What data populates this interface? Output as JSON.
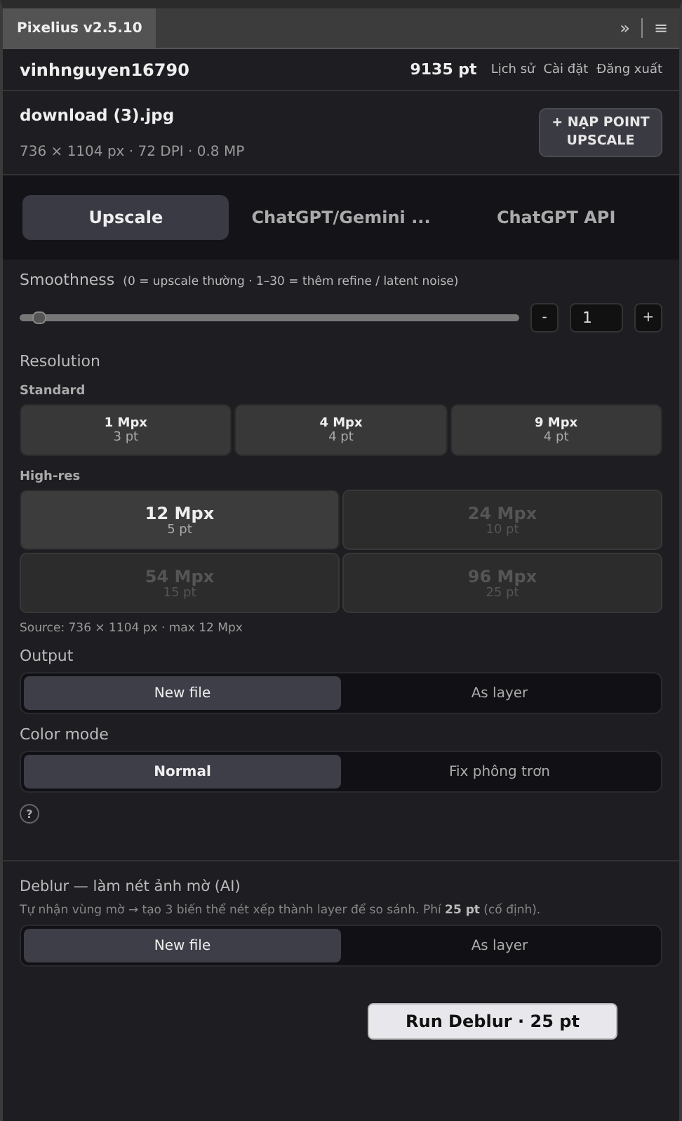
{
  "panel_tab": {
    "title": "Pixelius v2.5.10",
    "controls": [
      "»",
      "≡"
    ]
  },
  "account": {
    "username": "vinhnguyen16790",
    "points": "9135 pt",
    "links": [
      "Lịch sử",
      "Cài đặt",
      "Đăng xuất"
    ]
  },
  "file": {
    "name": "download (3).jpg",
    "info": "736 × 1104 px · 72 DPI · 0.8 MP",
    "topup_button": "+ NẠP POINT UPSCALE"
  },
  "tabs": [
    {
      "label": "Upscale",
      "selected": true
    },
    {
      "label": "ChatGPT/Gemini ...",
      "selected": false
    },
    {
      "label": "ChatGPT API",
      "selected": false
    }
  ],
  "smoothness": {
    "label": "Smoothness",
    "hint": "(0 = upscale thường · 1–30 = thêm refine / latent noise)",
    "level": 0.03,
    "minus": "-",
    "value": "1",
    "plus": "+"
  },
  "resolution": {
    "label": "Resolution",
    "standard": {
      "label": "Standard",
      "options": [
        {
          "size": "1 Mpx",
          "cost": "3 pt",
          "selected": false
        },
        {
          "size": "4 Mpx",
          "cost": "4 pt",
          "selected": false
        },
        {
          "size": "9 Mpx",
          "cost": "4 pt",
          "selected": false
        }
      ]
    },
    "high_res": {
      "label": "High-res",
      "options": [
        {
          "size": "12 Mpx",
          "cost": "5 pt",
          "disabled": false
        },
        {
          "size": "24 Mpx",
          "cost": "10 pt",
          "disabled": true
        },
        {
          "size": "54 Mpx",
          "cost": "15 pt",
          "disabled": true
        },
        {
          "size": "96 Mpx",
          "cost": "25 pt",
          "disabled": true
        }
      ]
    },
    "source_note": "Source: 736 × 1104 px · max 12 Mpx"
  },
  "output": {
    "label": "Output",
    "options": [
      {
        "label": "New file",
        "selected": true
      },
      {
        "label": "As layer",
        "selected": false
      }
    ]
  },
  "color_mode": {
    "label": "Color mode",
    "options": [
      {
        "label": "Normal",
        "selected": true
      },
      {
        "label": "Fix phông trơn",
        "selected": false
      }
    ],
    "help": "?"
  },
  "deblur": {
    "title": "Deblur — làm nét ảnh mờ (AI)",
    "description": "Tự nhận vùng mờ → tạo 3 biến thể nét xếp thành layer để so sánh. Phí **25 pt** (cố định).",
    "options": [
      {
        "label": "New file",
        "selected": true
      },
      {
        "label": "As layer",
        "selected": false
      }
    ],
    "run_button": "Run Deblur · 25 pt"
  }
}
